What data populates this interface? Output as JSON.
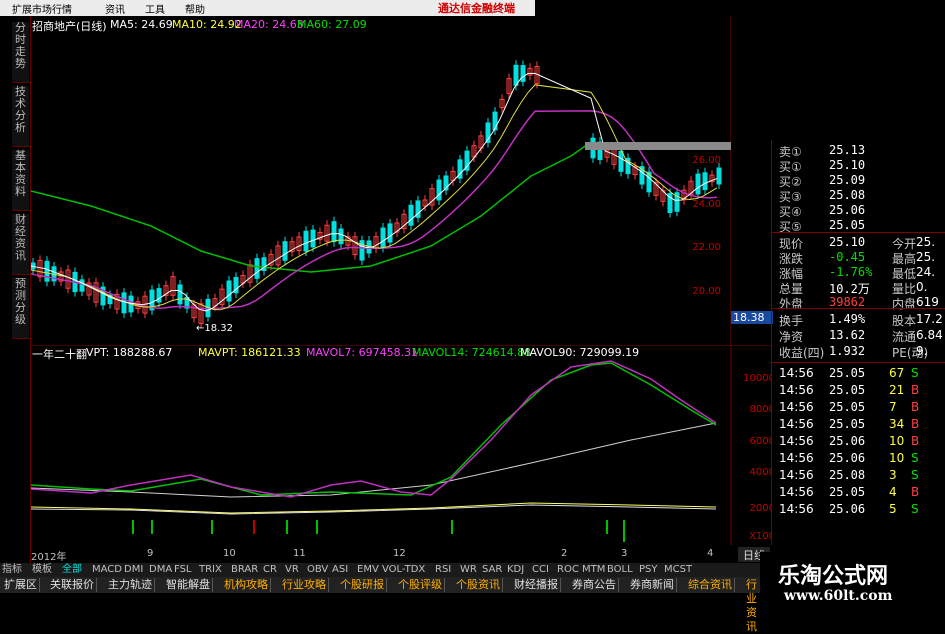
{
  "menu": {
    "items": [
      "扩展市场行情",
      "资讯",
      "工具",
      "帮助"
    ],
    "brand": "通达信金融终端"
  },
  "left_tabs": [
    "分时走势",
    "技术分析",
    "基本资料",
    "财经资讯",
    "预测分级"
  ],
  "header": {
    "stock": "招商地产(日线)",
    "ma5": "MA5: 24.69",
    "ma10": "MA10: 24.92",
    "ma20": "MA20: 24.63",
    "ma60": "MA60: 27.09"
  },
  "price_axis": [
    "26.00",
    "24.00",
    "22.00",
    "20.00"
  ],
  "price_marker": "18.38",
  "low_label": "←18.32",
  "volume_header": {
    "label": "一年二十翻",
    "vpt": "VPT: 188288.67",
    "mavpt": "MAVPT: 186121.33",
    "mavol7": "MAVOL7: 697458.31",
    "mavol14": "MAVOL14: 724614.88",
    "mavol90": "MAVOL90: 729099.19"
  },
  "volume_axis": [
    "10000",
    "8000",
    "6000",
    "4000",
    "2000",
    "X100"
  ],
  "time_axis": [
    "2012年",
    "9",
    "10",
    "11",
    "12",
    "2",
    "3",
    "4"
  ],
  "quote": {
    "orders": [
      {
        "label": "卖①",
        "price": "25.13"
      },
      {
        "label": "买①",
        "price": "25.10"
      },
      {
        "label": "买②",
        "price": "25.09"
      },
      {
        "label": "买③",
        "price": "25.08"
      },
      {
        "label": "买④",
        "price": "25.06"
      },
      {
        "label": "买⑤",
        "price": "25.05"
      }
    ],
    "stats": [
      {
        "l1": "现价",
        "v1": "25.10",
        "l2": "今开",
        "v2": "25."
      },
      {
        "l1": "涨跌",
        "v1": "-0.45",
        "l2": "最高",
        "v2": "25."
      },
      {
        "l1": "涨幅",
        "v1": "-1.76%",
        "l2": "最低",
        "v2": "24."
      },
      {
        "l1": "总量",
        "v1": "10.2万",
        "l2": "量比",
        "v2": "0."
      },
      {
        "l1": "外盘",
        "v1": "39862",
        "l2": "内盘",
        "v2": "619"
      }
    ],
    "fundamentals": [
      {
        "l1": "换手",
        "v1": "1.49%",
        "l2": "股本",
        "v2": "17.2"
      },
      {
        "l1": "净资",
        "v1": "13.62",
        "l2": "流通",
        "v2": "6.84"
      },
      {
        "l1": "收益(四)",
        "v1": "1.932",
        "l2": "PE(动)",
        "v2": "9."
      }
    ],
    "ticks": [
      {
        "time": "14:56",
        "price": "25.05",
        "vol": "67",
        "side": "S"
      },
      {
        "time": "14:56",
        "price": "25.05",
        "vol": "21",
        "side": "B"
      },
      {
        "time": "14:56",
        "price": "25.05",
        "vol": "7",
        "side": "B"
      },
      {
        "time": "14:56",
        "price": "25.05",
        "vol": "34",
        "side": "B"
      },
      {
        "time": "14:56",
        "price": "25.06",
        "vol": "10",
        "side": "B"
      },
      {
        "time": "14:56",
        "price": "25.06",
        "vol": "10",
        "side": "S"
      },
      {
        "time": "14:56",
        "price": "25.08",
        "vol": "3",
        "side": "S"
      },
      {
        "time": "14:56",
        "price": "25.05",
        "vol": "4",
        "side": "B"
      },
      {
        "time": "14:56",
        "price": "25.06",
        "vol": "5",
        "side": "S"
      }
    ]
  },
  "indicator_tabs": [
    "指标",
    "模板",
    "全部",
    "MACD",
    "DMI",
    "DMA",
    "FSL",
    "TRIX",
    "BRAR",
    "CR",
    "VR",
    "OBV",
    "ASI",
    "EMV",
    "VOL-TDX",
    "RSI",
    "WR",
    "SAR",
    "KDJ",
    "CCI",
    "ROC",
    "MTM",
    "BOLL",
    "PSY",
    "MCST"
  ],
  "bottom_buttons": [
    "扩展区",
    "关联报价",
    "主力轨迹",
    "智能解盘",
    "机构攻略",
    "行业攻略",
    "个股研报",
    "个股评级",
    "个股资讯",
    "财经播报",
    "券商公告",
    "券商新闻",
    "综合资讯",
    "行业资讯",
    "资讯"
  ],
  "right_tab": "日线",
  "logo": {
    "title": "乐淘公式网",
    "url": "www.60lt.com"
  },
  "colors": {
    "up": "#ff4040",
    "down": "#00e0e0",
    "ma5": "#ffffff",
    "ma10": "#ffff40",
    "ma20": "#ff40ff",
    "ma60": "#00e000"
  }
}
